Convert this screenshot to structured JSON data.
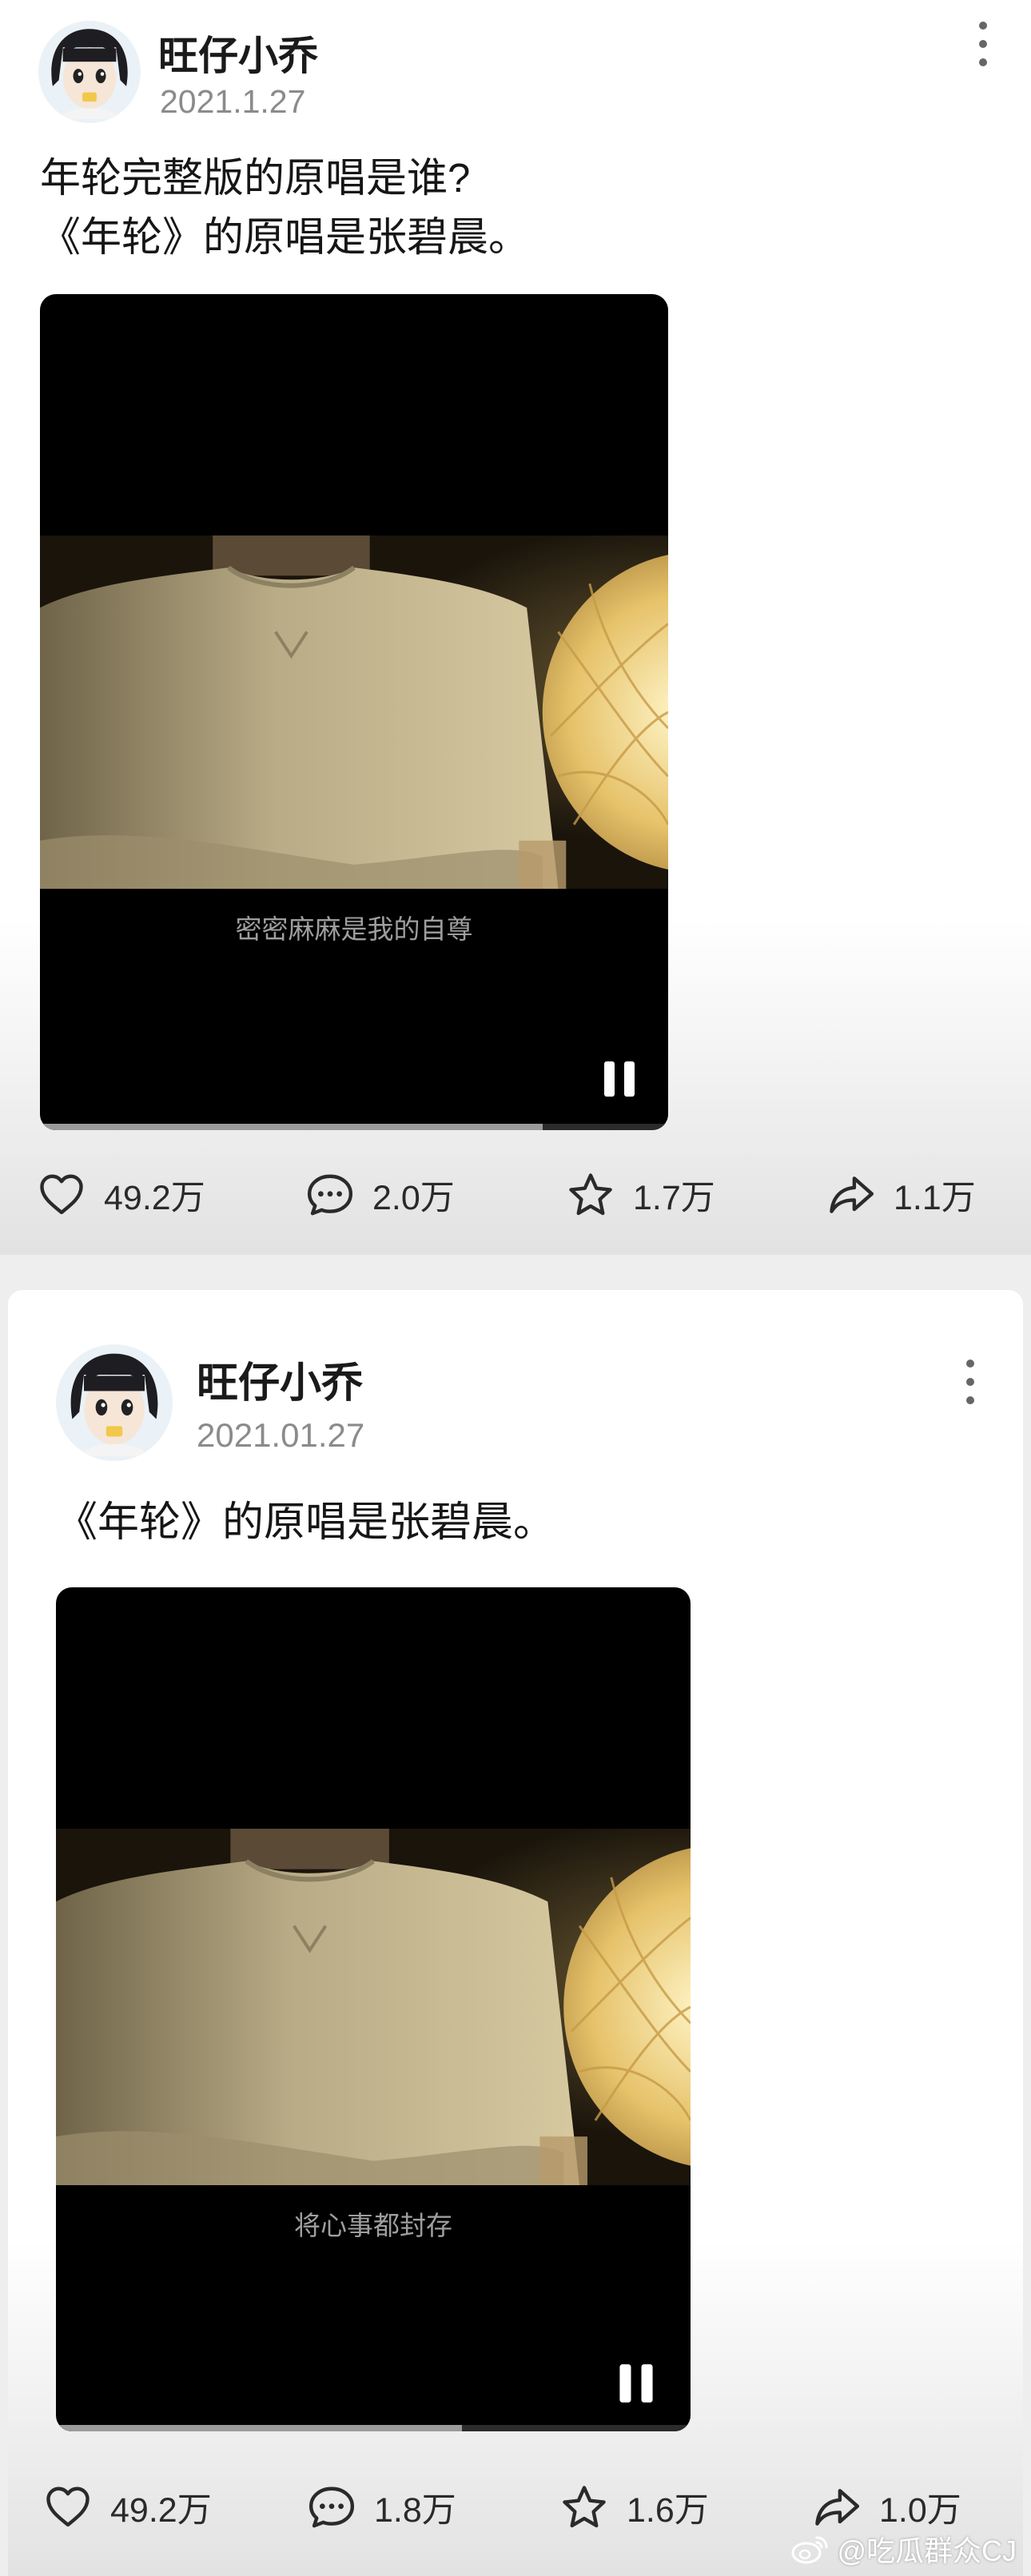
{
  "colors": {
    "page_bg": "#eeeeee",
    "card_bg": "#ffffff",
    "text_primary": "#161616",
    "text_secondary": "#8b8b8b",
    "video_bg": "#000000",
    "subtitle": "#9e9e9e",
    "icon": "#2a2a2a"
  },
  "posts": [
    {
      "author": "旺仔小乔",
      "date": "2021.1.27",
      "text_lines": [
        "年轮完整版的原唱是谁?",
        "《年轮》的原唱是张碧晨。"
      ],
      "video": {
        "subtitle": "密密麻麻是我的自尊",
        "state": "playing",
        "progress": 0.8
      },
      "actions": {
        "likes": "49.2万",
        "comments": "2.0万",
        "favorites": "1.7万",
        "shares": "1.1万"
      },
      "icons": [
        "heart-icon",
        "comment-icon",
        "star-icon",
        "share-icon",
        "more-vertical-icon",
        "pause-icon"
      ]
    },
    {
      "author": "旺仔小乔",
      "date": "2021.01.27",
      "text_lines": [
        "《年轮》的原唱是张碧晨。"
      ],
      "video": {
        "subtitle": "将心事都封存",
        "state": "playing",
        "progress": 0.64
      },
      "actions": {
        "likes": "49.2万",
        "comments": "1.8万",
        "favorites": "1.6万",
        "shares": "1.0万"
      },
      "icons": [
        "heart-icon",
        "comment-icon",
        "star-icon",
        "share-icon",
        "more-vertical-icon",
        "pause-icon"
      ]
    }
  ],
  "watermark": {
    "text": "@吃瓜群众CJ",
    "icon": "weibo-logo-icon"
  }
}
